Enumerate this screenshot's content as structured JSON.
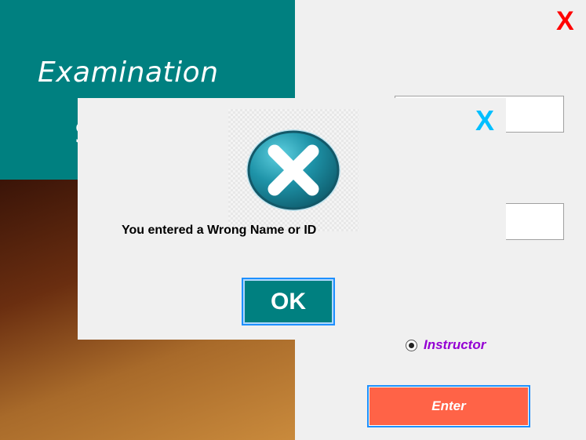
{
  "app": {
    "title_line1": "Examination",
    "title_line2": "S",
    "close_label": "X"
  },
  "form": {
    "name_value": "",
    "id_value": "",
    "radio_label": "Instructor",
    "radio_selected": true,
    "enter_label": "Enter"
  },
  "dialog": {
    "close_label": "X",
    "icon": "error-x-circle-icon",
    "message": "You entered a Wrong Name or ID",
    "ok_label": "OK"
  },
  "colors": {
    "teal": "#008080",
    "enter": "#ff6347",
    "close_red": "#ff0000",
    "dialog_close": "#00bfff",
    "radio_label": "#9400d3"
  }
}
